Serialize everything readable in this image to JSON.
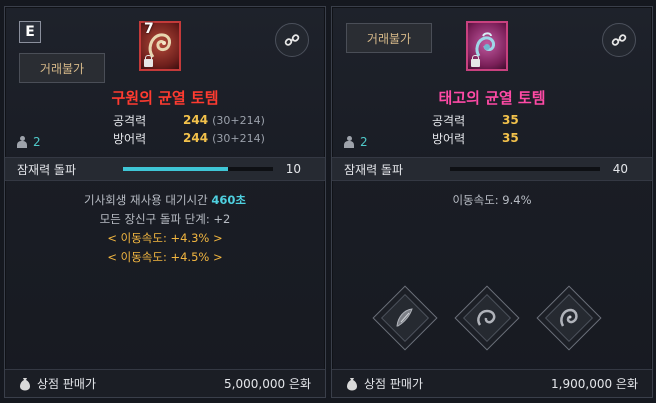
{
  "left": {
    "grade": "E",
    "trade_label": "거래불가",
    "icon_level": "7",
    "item_name": "구원의 균열 토템",
    "stats": [
      {
        "label": "공격력",
        "value": "244",
        "extra": "(30+214)"
      },
      {
        "label": "방어력",
        "value": "244",
        "extra": "(30+214)"
      }
    ],
    "count": "2",
    "section_label": "잠재력 돌파",
    "progress": 0.7,
    "section_value": "10",
    "effects": {
      "line1_prefix": "기사회생 재사용 대기시간 ",
      "line1_highlight": "460초",
      "line2": "모든 장신구 돌파 단계: +2",
      "line3": "< 이동속도: +4.3% >",
      "line4": "< 이동속도: +4.5% >"
    },
    "footer_label": "상점 판매가",
    "footer_price": "5,000,000 은화"
  },
  "right": {
    "trade_label": "거래불가",
    "item_name": "태고의 균열 토템",
    "stats": [
      {
        "label": "공격력",
        "value": "35"
      },
      {
        "label": "방어력",
        "value": "35"
      }
    ],
    "count": "2",
    "section_label": "잠재력 돌파",
    "progress": 0.0,
    "section_value": "40",
    "effect": "이동속도: 9.4%",
    "footer_label": "상점 판매가",
    "footer_price": "1,900,000 은화"
  },
  "colors": {
    "accent_cyan": "#3fc6d6",
    "name_red": "#ff3b30",
    "name_pink": "#ff4aa6",
    "stat_gold": "#f2c14b"
  },
  "icons": [
    "link-icon",
    "person-icon",
    "money-bag-icon",
    "lock-icon",
    "totem-icon",
    "relic-icon"
  ]
}
